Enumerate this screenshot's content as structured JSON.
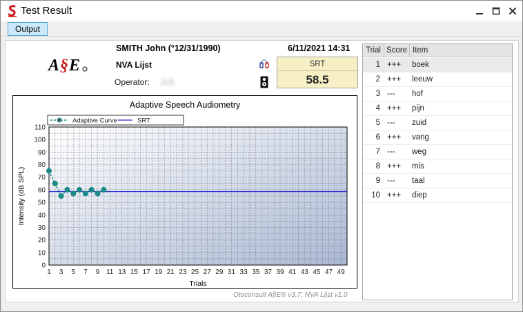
{
  "window": {
    "title": "Test Result"
  },
  "toolbar": {
    "output_label": "Output"
  },
  "header": {
    "patient": "SMITH John (°12/31/1990)",
    "list": "NVA Lijst",
    "list_extra": "",
    "operator_label": "Operator:",
    "operator_value": "JoS",
    "datetime": "6/11/2021 14:31",
    "logo_text": "A§E"
  },
  "srt": {
    "label": "SRT",
    "value": "58.5"
  },
  "chart_data": {
    "type": "line",
    "title": "Adaptive Speech Audiometry",
    "xlabel": "Trials",
    "ylabel": "Intensity (dB SPL)",
    "xlim": [
      1,
      50
    ],
    "ylim": [
      0,
      110
    ],
    "x_ticks": [
      1,
      3,
      5,
      7,
      9,
      11,
      13,
      15,
      17,
      19,
      21,
      23,
      25,
      27,
      29,
      31,
      33,
      35,
      37,
      39,
      41,
      43,
      45,
      47,
      49
    ],
    "y_ticks": [
      0,
      10,
      20,
      30,
      40,
      50,
      60,
      70,
      80,
      90,
      100,
      110
    ],
    "grid": true,
    "legend_position": "top-left",
    "series": [
      {
        "name": "Adaptive Curve",
        "color": "#1a8a87",
        "x": [
          1,
          2,
          3,
          4,
          5,
          6,
          7,
          8,
          9,
          10
        ],
        "y": [
          75,
          65,
          55,
          60,
          57,
          60,
          57,
          60,
          57,
          60
        ]
      },
      {
        "name": "SRT",
        "color": "#2a2ad0",
        "value": 58.5
      }
    ]
  },
  "footer": {
    "note": "Otoconsult A§E® v3.7; NVA Lijst v1.0"
  },
  "table": {
    "headers": {
      "trial": "Trial",
      "score": "Score",
      "item": "Item"
    },
    "rows": [
      {
        "trial": "1",
        "score": "+++",
        "item": "boek"
      },
      {
        "trial": "2",
        "score": "+++",
        "item": "leeuw"
      },
      {
        "trial": "3",
        "score": "---",
        "item": "hof"
      },
      {
        "trial": "4",
        "score": "+++",
        "item": "pijn"
      },
      {
        "trial": "5",
        "score": "---",
        "item": "zuid"
      },
      {
        "trial": "6",
        "score": "+++",
        "item": "vang"
      },
      {
        "trial": "7",
        "score": "---",
        "item": "weg"
      },
      {
        "trial": "8",
        "score": "+++",
        "item": "mis"
      },
      {
        "trial": "9",
        "score": "---",
        "item": "taal"
      },
      {
        "trial": "10",
        "score": "+++",
        "item": "diep"
      }
    ]
  }
}
